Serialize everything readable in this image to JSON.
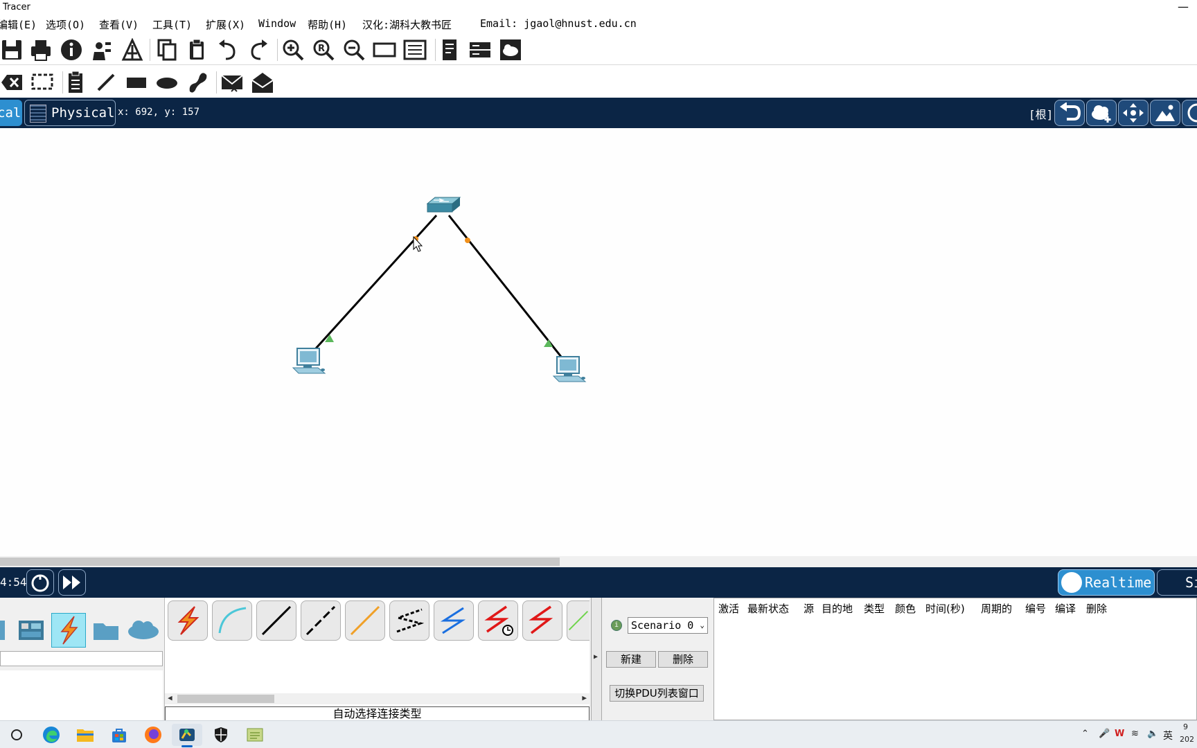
{
  "window": {
    "title": "Tracer",
    "minimize_glyph": "—"
  },
  "menu": [
    {
      "label": "编辑(E)"
    },
    {
      "label": "选项(O)"
    },
    {
      "label": "查看(V)"
    },
    {
      "label": "工具(T)"
    },
    {
      "label": "扩展(X)"
    },
    {
      "label": "Window"
    },
    {
      "label": "帮助(H)"
    },
    {
      "label": "汉化:湖科大教书匠"
    },
    {
      "label": "Email: jgaol@hnust.edu.cn"
    }
  ],
  "toolbar1_icons": [
    "save-icon",
    "print-icon",
    "info-icon",
    "wizard-icon",
    "network-icon",
    "copy-icon",
    "paste-icon",
    "undo-icon",
    "redo-icon",
    "zoom-in-icon",
    "zoom-reset-icon",
    "zoom-out-icon",
    "window-icon",
    "list-icon",
    "notes-icon",
    "device-icon",
    "cloud-icon"
  ],
  "toolbar2_icons": [
    "delete-icon",
    "select-icon",
    "note-icon",
    "line-icon",
    "rectangle-icon",
    "ellipse-icon",
    "freeform-icon",
    "simple-pdu-icon",
    "complex-pdu-icon"
  ],
  "nav": {
    "logical_tab": "cal",
    "physical_tab": "Physical",
    "coords": "x: 692, y: 157",
    "root": "[根]"
  },
  "topology": {
    "devices": [
      {
        "name": "switch",
        "type": "switch-icon"
      },
      {
        "name": "pc-left",
        "type": "pc-icon"
      },
      {
        "name": "pc-right",
        "type": "pc-icon"
      }
    ],
    "links": [
      {
        "from": "switch",
        "to": "pc-left",
        "switch_end": "orange",
        "pc_end": "green"
      },
      {
        "from": "switch",
        "to": "pc-right",
        "switch_end": "orange",
        "pc_end": "green"
      }
    ],
    "colors": {
      "link": "#000000",
      "port_up": "#5cb85c",
      "port_blocking": "#f0901c"
    }
  },
  "sim": {
    "time": "4:54",
    "realtime_label": "Realtime",
    "simulation_label": "Si"
  },
  "device_categories": [
    "end-device-icon",
    "component-icon",
    "connection-icon",
    "misc-icon",
    "multiuser-icon"
  ],
  "connections": {
    "types": [
      "auto-icon",
      "console-icon",
      "copper-straight-icon",
      "copper-cross-icon",
      "fiber-icon",
      "phone-icon",
      "coaxial-icon",
      "serial-dce-icon",
      "serial-dte-icon",
      "octal-icon"
    ],
    "status": "自动选择连接类型"
  },
  "scenario": {
    "selected": "Scenario 0",
    "new_label": "新建",
    "delete_label": "删除",
    "toggle_label": "切换PDU列表窗口"
  },
  "pdu_columns": [
    "激活",
    "最新状态",
    "源",
    "目的地",
    "类型",
    "颜色",
    "时间(秒)",
    "周期的",
    "编号",
    "编译",
    "删除"
  ],
  "tray": {
    "lang": "英",
    "clock_top": "9",
    "clock_bottom": "202"
  }
}
